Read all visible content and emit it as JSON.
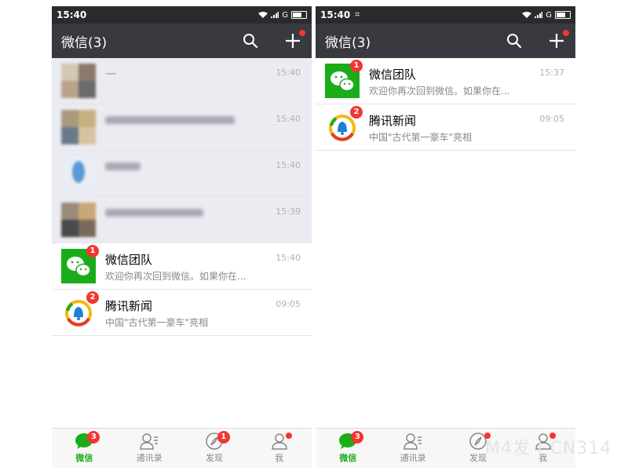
{
  "left": {
    "status": {
      "time": "15:40",
      "carrier": "G",
      "extra": ""
    },
    "header": {
      "title": "微信(3)"
    },
    "chats": [
      {
        "name": "—",
        "preview": "",
        "time": "15:40",
        "hidden": true,
        "avatar_colors": [
          "#d4c7b6",
          "#8a7a6a",
          "#b9a38c",
          "#6b6b6b"
        ]
      },
      {
        "name": "",
        "preview": "",
        "time": "15:40",
        "hidden": true,
        "avatar_colors": [
          "#a89a7a",
          "#c8b080",
          "#6b7a8a",
          "#d6c4a0"
        ]
      },
      {
        "name": "",
        "preview": "",
        "time": "15:40",
        "hidden": true,
        "avatar_colors": [
          "#c8d8e8",
          "#5a9ad6",
          "#e8eef4",
          "#7fb0de"
        ]
      },
      {
        "name": "",
        "preview": "",
        "time": "15:39",
        "hidden": true,
        "avatar_colors": [
          "#9a8a7a",
          "#4a4a4a",
          "#c8a878",
          "#7a6a5a"
        ]
      },
      {
        "name": "微信团队",
        "preview": "欢迎你再次回到微信。如果你在...",
        "time": "15:40",
        "badge": "1",
        "avatar": "wechat-icon"
      },
      {
        "name": "腾讯新闻",
        "preview": "中国\"古代第一豪车\"亮相",
        "time": "09:05",
        "badge": "2",
        "avatar": "tencent-news-icon"
      }
    ],
    "tabs": [
      {
        "label": "微信",
        "badge": "3",
        "active": true,
        "icon": "chat-icon"
      },
      {
        "label": "通讯录",
        "icon": "contacts-icon"
      },
      {
        "label": "发现",
        "badge": "1",
        "icon": "compass-icon"
      },
      {
        "label": "我",
        "dot": true,
        "icon": "person-icon"
      }
    ]
  },
  "right": {
    "status": {
      "time": "15:40",
      "carrier": "G",
      "extra": "⌗"
    },
    "header": {
      "title": "微信(3)"
    },
    "chats": [
      {
        "name": "微信团队",
        "preview": "欢迎你再次回到微信。如果你在...",
        "time": "15:37",
        "badge": "1",
        "avatar": "wechat-icon"
      },
      {
        "name": "腾讯新闻",
        "preview": "中国\"古代第一豪车\"亮相",
        "time": "09:05",
        "badge": "2",
        "avatar": "tencent-news-icon"
      }
    ],
    "tabs": [
      {
        "label": "微信",
        "badge": "3",
        "active": true,
        "icon": "chat-icon"
      },
      {
        "label": "通讯录",
        "icon": "contacts-icon"
      },
      {
        "label": "发现",
        "dot": true,
        "icon": "compass-icon"
      },
      {
        "label": "我",
        "dot": true,
        "icon": "person-icon"
      }
    ]
  },
  "watermark": "M4发 | CN314",
  "colors": {
    "accent": "#1aad19",
    "header": "#393a3f",
    "badge": "#f43530",
    "muted_row": "#ebebf2"
  }
}
